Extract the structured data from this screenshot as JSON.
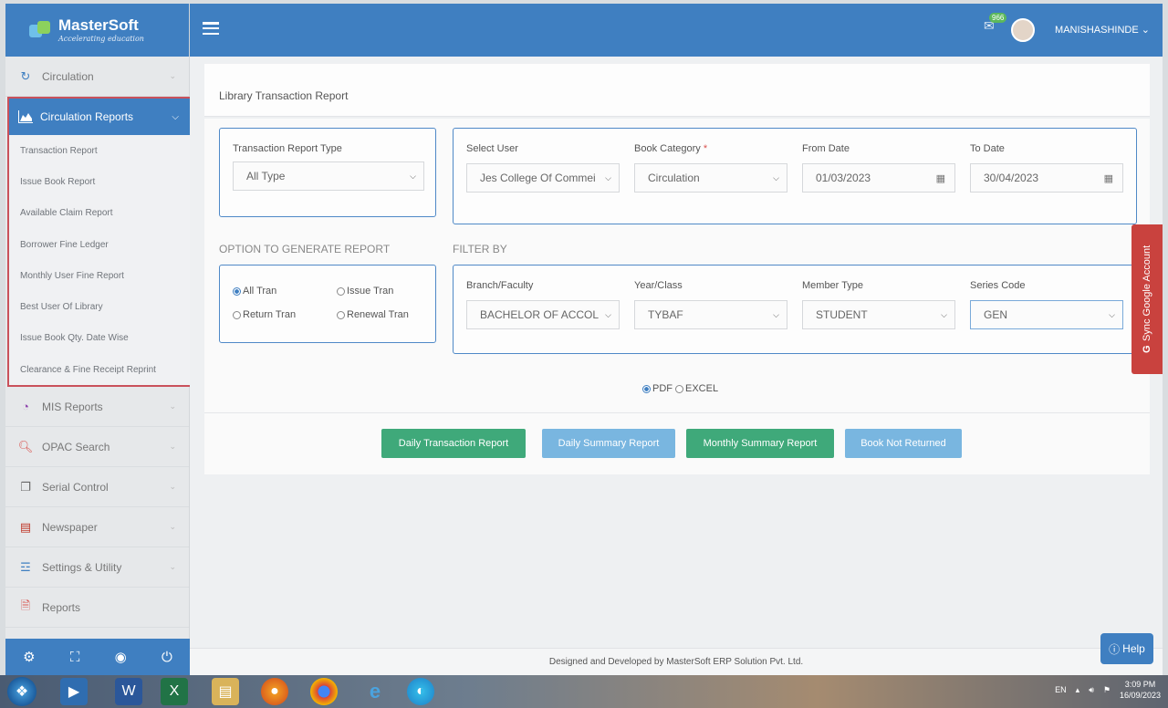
{
  "brand": {
    "name": "MasterSoft",
    "tagline": "Accelerating education"
  },
  "topbar": {
    "notification_count": "966",
    "user_name": "MANISHASHINDE"
  },
  "sidebar": {
    "items_top": [
      {
        "label": "Circulation",
        "icon": "refresh-icon"
      }
    ],
    "active_group": {
      "label": "Circulation Reports",
      "sub_items": [
        "Transaction Report",
        "Issue Book Report",
        "Available Claim Report",
        "Borrower Fine Ledger",
        "Monthly User Fine Report",
        "Best User Of Library",
        "Issue Book Qty. Date Wise",
        "Clearance & Fine Receipt Reprint"
      ]
    },
    "items_bottom": [
      {
        "label": "MIS Reports"
      },
      {
        "label": "OPAC Search"
      },
      {
        "label": "Serial Control"
      },
      {
        "label": "Newspaper"
      },
      {
        "label": "Settings & Utility"
      },
      {
        "label": "Reports"
      }
    ]
  },
  "page": {
    "title": "Library Transaction Report"
  },
  "form": {
    "transaction_type": {
      "label": "Transaction Report Type",
      "value": "All Type"
    },
    "select_user": {
      "label": "Select User",
      "value": "Jes College Of Commei"
    },
    "book_category": {
      "label": "Book Category",
      "required": "*",
      "value": "Circulation"
    },
    "from_date": {
      "label": "From Date",
      "value": "01/03/2023"
    },
    "to_date": {
      "label": "To Date",
      "value": "30/04/2023"
    },
    "options_title": "OPTION TO GENERATE REPORT",
    "options": {
      "all_tran": "All Tran",
      "issue_tran": "Issue Tran",
      "return_tran": "Return Tran",
      "renewal_tran": "Renewal Tran"
    },
    "filter_title": "FILTER BY",
    "branch": {
      "label": "Branch/Faculty",
      "value": "BACHELOR OF ACCOL"
    },
    "year_class": {
      "label": "Year/Class",
      "value": "TYBAF"
    },
    "member_type": {
      "label": "Member Type",
      "value": "STUDENT"
    },
    "series_code": {
      "label": "Series Code",
      "value": "GEN"
    },
    "format": {
      "pdf": "PDF",
      "excel": "EXCEL"
    }
  },
  "buttons": {
    "daily_transaction": "Daily Transaction Report",
    "daily_summary": "Daily Summary Report",
    "monthly_summary": "Monthly Summary Report",
    "book_not_returned": "Book Not Returned"
  },
  "sync_google": "Sync Google Account",
  "footer": "Designed and Developed by MasterSoft ERP Solution Pvt. Ltd.",
  "help": "Help",
  "taskbar": {
    "lang": "EN",
    "time": "3:09 PM",
    "date": "16/09/2023"
  },
  "colors": {
    "primary": "#3f7fc1",
    "green": "#3fa97a",
    "light_blue": "#79b6e0",
    "danger": "#c9423e",
    "highlight": "#c9515b"
  }
}
